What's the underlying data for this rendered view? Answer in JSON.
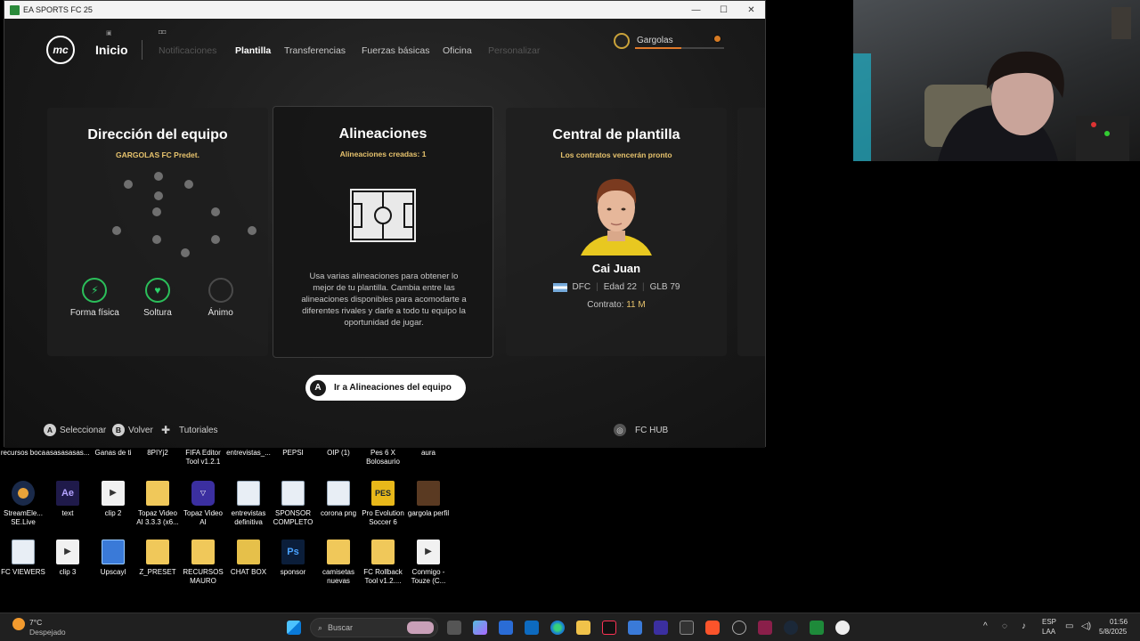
{
  "window": {
    "title": "EA SPORTS FC 25",
    "controls": [
      "—",
      "☐",
      "✕"
    ]
  },
  "nav": {
    "logo": "mc",
    "home": "Inicio",
    "items": [
      {
        "label": "Notificaciones",
        "state": "dim"
      },
      {
        "label": "Plantilla",
        "state": "active"
      },
      {
        "label": "Transferencias",
        "state": "normal"
      },
      {
        "label": "Fuerzas básicas",
        "state": "normal"
      },
      {
        "label": "Oficina",
        "state": "normal"
      },
      {
        "label": "Personalizar",
        "state": "dim"
      }
    ],
    "profile_name": "Gargolas",
    "profile_progress": 0.52
  },
  "panels": {
    "direction": {
      "title": "Dirección del equipo",
      "subtitle": "GARGOLAS FC Predet.",
      "stats": [
        {
          "label": "Forma física",
          "icon": "bolt-icon",
          "glyph": "⚡",
          "filled": true
        },
        {
          "label": "Soltura",
          "icon": "heart-icon",
          "glyph": "♥",
          "filled": true
        },
        {
          "label": "Ánimo",
          "icon": "mood-icon",
          "glyph": "",
          "filled": false
        }
      ]
    },
    "lineups": {
      "title": "Alineaciones",
      "subtitle": "Alineaciones creadas: 1",
      "description": "Usa varias alineaciones para obtener lo mejor de tu plantilla. Cambia entre las alineaciones disponibles para acomodarte a diferentes rivales y darle a todo tu equipo la oportunidad de jugar."
    },
    "squad_hub": {
      "title": "Central de plantilla",
      "subtitle": "Los contratos vencerán pronto",
      "player_name": "Cai Juan",
      "position": "DFC",
      "age": "Edad 22",
      "overall": "GLB 79",
      "contract_label": "Contrato:",
      "contract_value": "11 M"
    }
  },
  "cta": {
    "button_key": "A",
    "label": "Ir a Alineaciones del equipo"
  },
  "hints": {
    "select_key": "A",
    "select": "Seleccionar",
    "back_key": "B",
    "back": "Volver",
    "tutorials": "Tutoriales",
    "hub": "FC HUB"
  },
  "desktop": {
    "row1": [
      "recursos boca",
      "asasasasas...",
      "Ganas de ti",
      "8PIYj2",
      "FIFA Editor Tool v1.2.1",
      "entrevistas_...",
      "PEPSI",
      "OIP (1)",
      "Pes 6 X Bolosaurio",
      "aura"
    ],
    "row2": [
      "StreamEle... SE.Live",
      "text",
      "clip 2",
      "Topaz Video AI 3.3.3 (x6...",
      "Topaz Video AI",
      "entrevistas definitiva",
      "SPONSOR COMPLETO",
      "corona png",
      "Pro Evolution Soccer 6",
      "gargola perfil"
    ],
    "row3": [
      "FC VIEWERS",
      "clip 3",
      "Upscayl",
      "Z_PRESET",
      "RECURSOS MAURO",
      "CHAT BOX",
      "sponsor",
      "camisetas nuevas",
      "FC Rollback Tool v1.2....",
      "Conmigo - Touze (C..."
    ],
    "ae_label": "Ae",
    "ps_label": "Ps",
    "pes_label": "PES"
  },
  "taskbar": {
    "weather_temp": "7°C",
    "weather_desc": "Despejado",
    "search_placeholder": "Buscar",
    "lang": "ESP",
    "lang2": "LAA",
    "time": "01:56",
    "date": "5/8/2025"
  }
}
